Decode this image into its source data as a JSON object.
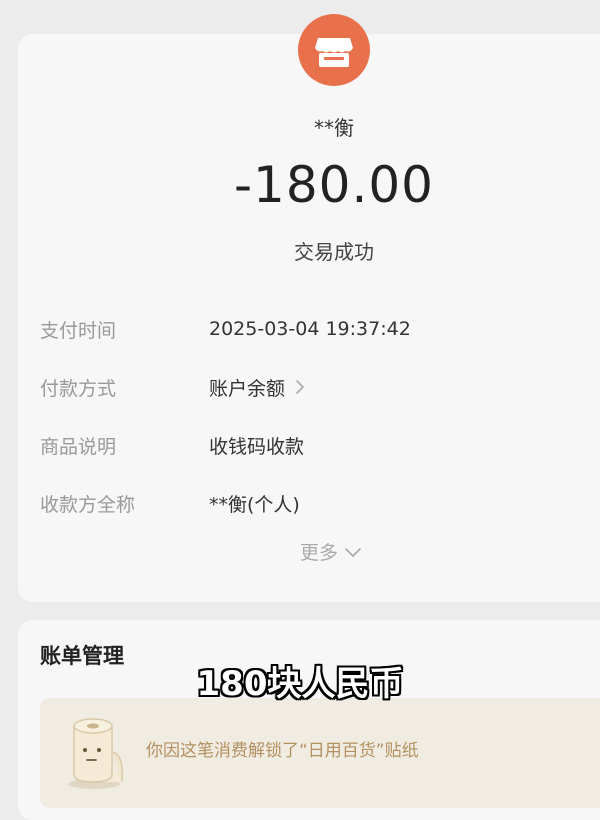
{
  "merchant": {
    "icon": "store-icon",
    "name": "**衡"
  },
  "amount": "-180.00",
  "status": "交易成功",
  "details": [
    {
      "label": "支付时间",
      "value": "2025-03-04 19:37:42",
      "has_arrow": false
    },
    {
      "label": "付款方式",
      "value": "账户余额",
      "has_arrow": true
    },
    {
      "label": "商品说明",
      "value": "收钱码收款",
      "has_arrow": false
    },
    {
      "label": "收款方全称",
      "value": "**衡(个人)",
      "has_arrow": false
    }
  ],
  "more_label": "更多",
  "bill_section": {
    "title": "账单管理",
    "sticker_banner": "你因这笔消费解锁了“日用百货”贴纸",
    "sticker_icon": "toilet-paper-icon"
  },
  "caption": "180块人民币",
  "colors": {
    "brand_orange": "#e8704a",
    "banner_bg": "#f1ece2",
    "banner_text": "#b39060",
    "label_gray": "#999999"
  }
}
